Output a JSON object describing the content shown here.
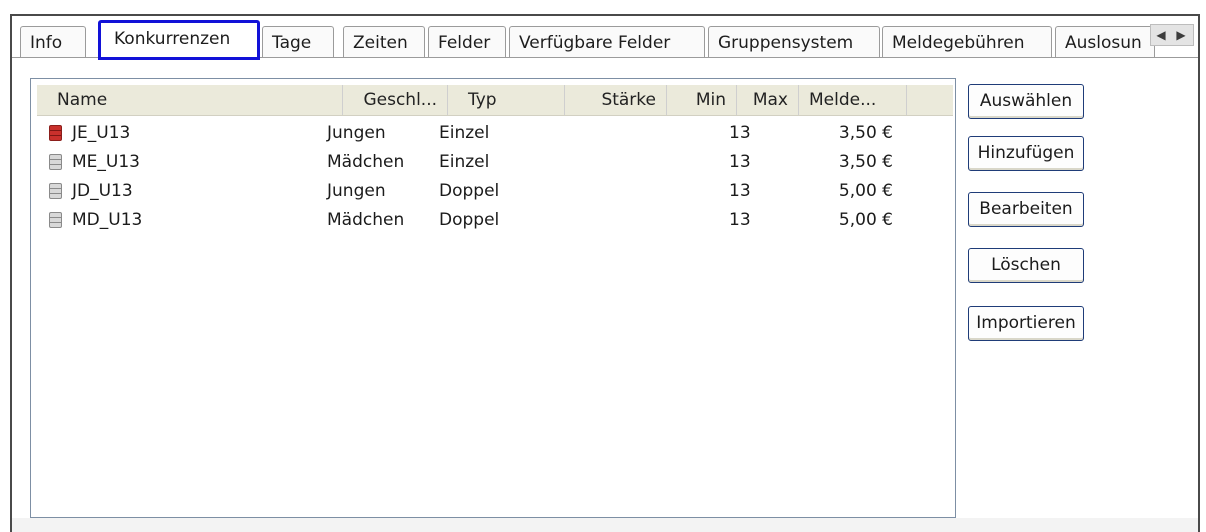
{
  "tabs": [
    {
      "label": "Info",
      "active": false
    },
    {
      "label": "Konkurrenzen",
      "active": true
    },
    {
      "label": "Tage",
      "active": false
    },
    {
      "label": "Zeiten",
      "active": false
    },
    {
      "label": "Felder",
      "active": false
    },
    {
      "label": "Verfügbare Felder",
      "active": false
    },
    {
      "label": "Gruppensystem",
      "active": false
    },
    {
      "label": "Meldegebühren",
      "active": false
    },
    {
      "label": "Auslosun",
      "active": false
    }
  ],
  "highlight_color": "#1212d8",
  "columns": [
    "Name",
    "Geschl...",
    "Typ",
    "Stärke",
    "Min",
    "Max",
    "Melde..."
  ],
  "rows": [
    {
      "icon": "database-red-icon",
      "name": "JE_U13",
      "gender": "Jungen",
      "type": "Einzel",
      "strength": "",
      "min": "",
      "max": "13",
      "fee": "3,50 €"
    },
    {
      "icon": "database-gray-icon",
      "name": "ME_U13",
      "gender": "Mädchen",
      "type": "Einzel",
      "strength": "",
      "min": "",
      "max": "13",
      "fee": "3,50 €"
    },
    {
      "icon": "database-gray-icon",
      "name": "JD_U13",
      "gender": "Jungen",
      "type": "Doppel",
      "strength": "",
      "min": "",
      "max": "13",
      "fee": "5,00 €"
    },
    {
      "icon": "database-gray-icon",
      "name": "MD_U13",
      "gender": "Mädchen",
      "type": "Doppel",
      "strength": "",
      "min": "",
      "max": "13",
      "fee": "5,00 €"
    }
  ],
  "buttons": {
    "select": "Auswählen",
    "add": "Hinzufügen",
    "edit": "Bearbeiten",
    "delete": "Löschen",
    "import": "Importieren"
  },
  "icon_colors": {
    "red": "#c9302c",
    "gray": "#9a9a9a"
  }
}
